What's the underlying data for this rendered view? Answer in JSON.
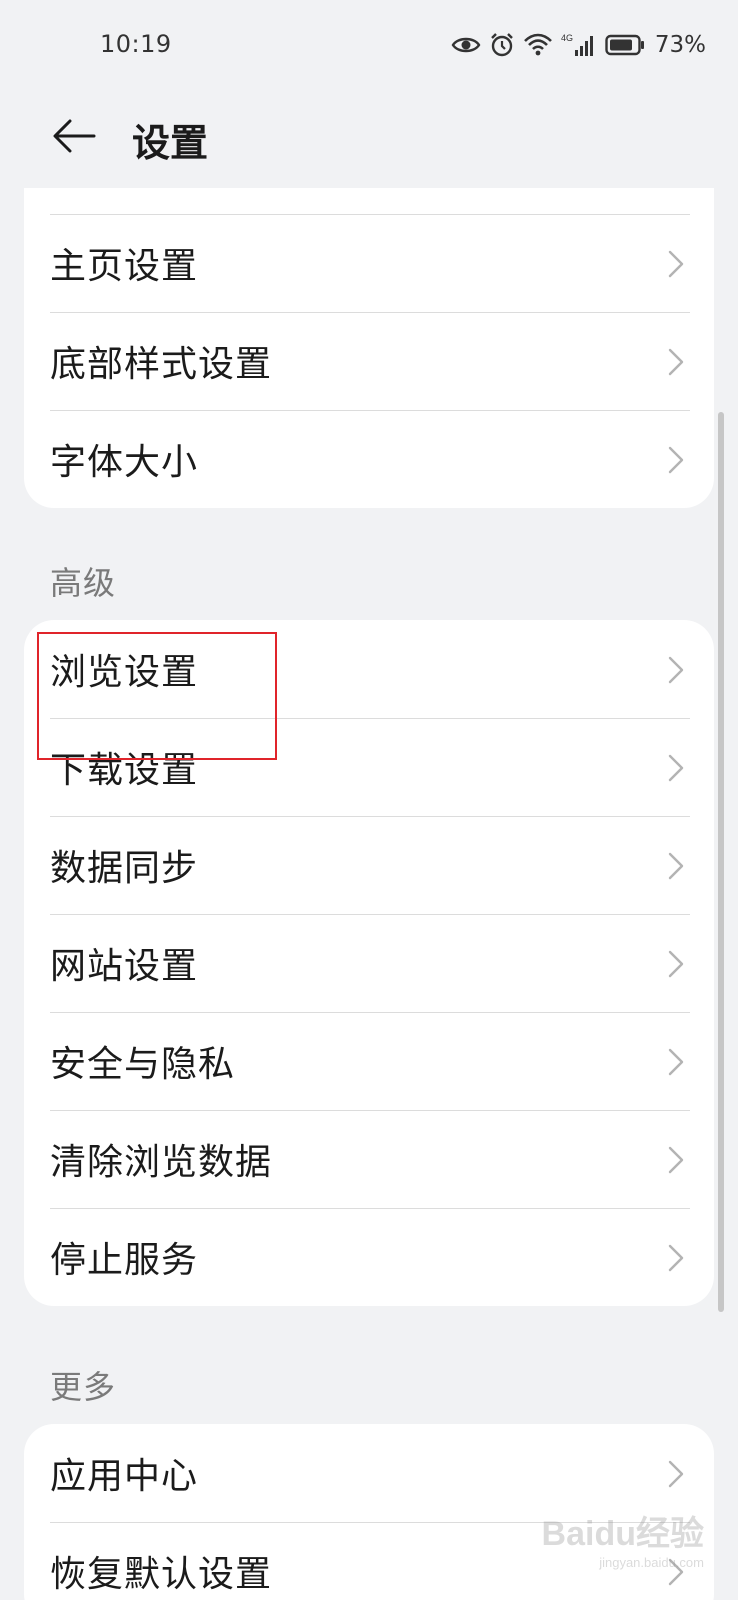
{
  "status_bar": {
    "time": "10:19",
    "network": "4G",
    "battery": "73%"
  },
  "header": {
    "back_icon": "arrow-left-icon",
    "title": "设置"
  },
  "group_general": {
    "items": [
      {
        "label": ""
      },
      {
        "label": "主页设置"
      },
      {
        "label": "底部样式设置"
      },
      {
        "label": "字体大小"
      }
    ]
  },
  "group_advanced": {
    "title": "高级",
    "items": [
      {
        "label": "浏览设置"
      },
      {
        "label": "下载设置"
      },
      {
        "label": "数据同步"
      },
      {
        "label": "网站设置"
      },
      {
        "label": "安全与隐私"
      },
      {
        "label": "清除浏览数据"
      },
      {
        "label": "停止服务"
      }
    ]
  },
  "group_more": {
    "title": "更多",
    "items": [
      {
        "label": "应用中心"
      },
      {
        "label": "恢复默认设置"
      }
    ]
  },
  "watermark": {
    "logo": "Baidu经验",
    "url": "jingyan.baidu.com"
  },
  "colors": {
    "background": "#f1f2f4",
    "card": "#ffffff",
    "highlight": "#e0242a",
    "secondary_text": "#7a7a7a"
  }
}
